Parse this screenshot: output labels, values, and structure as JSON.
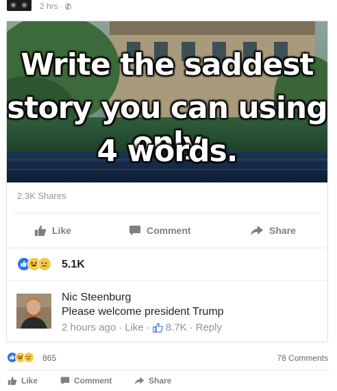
{
  "post": {
    "time": "2 hrs",
    "privacy_icon": "globe-icon"
  },
  "shared_post": {
    "image_text": {
      "line1": "Write the saddest",
      "line2": "story you can using only",
      "line3": "4 words."
    },
    "shares": "2.3K Shares",
    "actions": {
      "like": "Like",
      "comment": "Comment",
      "share": "Share"
    },
    "reactions": {
      "icons": [
        "like-reaction-icon",
        "haha-reaction-icon",
        "sad-reaction-icon"
      ],
      "count": "5.1K"
    },
    "top_comment": {
      "author": "Nic Steenburg",
      "text": "Please welcome president Trump",
      "time": "2 hours ago",
      "like_link": "Like",
      "like_count": "8.7K",
      "reply_link": "Reply",
      "separator": "·"
    }
  },
  "outer": {
    "reaction_count": "865",
    "comments_count": "78 Comments",
    "actions": {
      "like": "Like",
      "comment": "Comment",
      "share": "Share"
    }
  },
  "colors": {
    "facebook_blue": "#2e73e8",
    "reaction_yellow": "#f7c844",
    "muted_text": "#90949c",
    "action_gray": "#7f7f7f"
  }
}
